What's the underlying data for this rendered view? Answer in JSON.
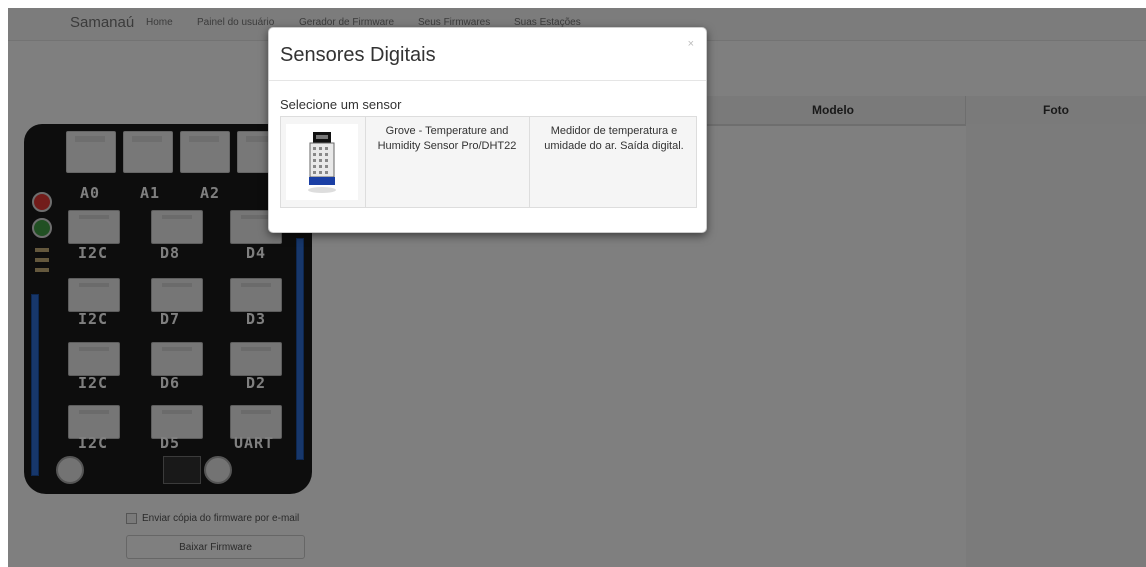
{
  "navbar": {
    "brand": "Samanaú",
    "links": [
      "Home",
      "Painel do usuário",
      "Gerador de Firmware",
      "Seus Firmwares",
      "Suas Estações"
    ]
  },
  "board": {
    "top_ports": [
      "A0",
      "A1",
      "A2"
    ],
    "rows": [
      [
        "I2C",
        "D8",
        "D4"
      ],
      [
        "I2C",
        "D7",
        "D3"
      ],
      [
        "I2C",
        "D6",
        "D2"
      ],
      [
        "I2C",
        "D5",
        "UART"
      ]
    ]
  },
  "form": {
    "email_copy_label": "Enviar cópia do firmware por e-mail",
    "download_button": "Baixar Firmware"
  },
  "table_headers": {
    "model": "Modelo",
    "photo": "Foto"
  },
  "modal": {
    "title": "Sensores Digitais",
    "close": "×",
    "prompt": "Selecione um sensor",
    "sensor": {
      "name_line1": "Grove - Temperature and",
      "name_line2": "Humidity Sensor Pro/DHT22",
      "desc_line1": "Medidor de temperatura e",
      "desc_line2": "umidade do ar. Saída digital."
    }
  },
  "colors": {
    "backdrop": "#000000",
    "board": "#1b1b1b",
    "header_pins": "#2f6fd6",
    "led_red": "#e53935",
    "led_green": "#43a047"
  }
}
